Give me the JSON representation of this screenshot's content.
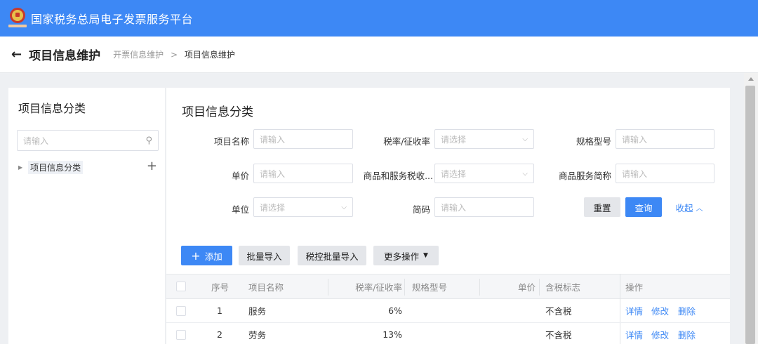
{
  "app": {
    "title": "国家税务总局电子发票服务平台"
  },
  "header": {
    "title": "项目信息维护",
    "breadcrumb": [
      "开票信息维护",
      "项目信息维护"
    ],
    "breadcrumb_sep": ">"
  },
  "sidebar": {
    "title": "项目信息分类",
    "search_placeholder": "请输入",
    "tree": [
      {
        "label": "项目信息分类"
      }
    ]
  },
  "main": {
    "title": "项目信息分类",
    "filters": {
      "item_name": {
        "label": "项目名称",
        "placeholder": "请输入"
      },
      "tax_rate": {
        "label": "税率/征收率",
        "placeholder": "请选择"
      },
      "spec": {
        "label": "规格型号",
        "placeholder": "请输入"
      },
      "unit_price": {
        "label": "单价",
        "placeholder": "请输入"
      },
      "tax_code": {
        "label": "商品和服务税收...",
        "placeholder": "请选择"
      },
      "short_name": {
        "label": "商品服务简称",
        "placeholder": "请输入"
      },
      "unit": {
        "label": "单位",
        "placeholder": "请选择"
      },
      "code": {
        "label": "简码",
        "placeholder": "请输入"
      }
    },
    "buttons": {
      "reset": "重置",
      "search": "查询",
      "collapse": "收起",
      "add": "添加",
      "batch_import": "批量导入",
      "tax_batch_import": "税控批量导入",
      "more": "更多操作"
    },
    "table": {
      "columns": [
        "序号",
        "项目名称",
        "税率/征收率",
        "规格型号",
        "单价",
        "含税标志",
        "操作"
      ],
      "rows": [
        {
          "index": "1",
          "name": "服务",
          "rate": "6%",
          "spec": "",
          "price": "",
          "tax_flag": "不含税"
        },
        {
          "index": "2",
          "name": "劳务",
          "rate": "13%",
          "spec": "",
          "price": "",
          "tax_flag": "不含税"
        }
      ],
      "actions": [
        "详情",
        "修改",
        "删除"
      ]
    }
  },
  "colors": {
    "primary": "#3d88f5",
    "background": "#eef0f3"
  },
  "icons": [
    "back-arrow-icon",
    "search-icon",
    "plus-icon",
    "chevron-down-icon",
    "chevron-up-icon",
    "caret-right-icon"
  ]
}
